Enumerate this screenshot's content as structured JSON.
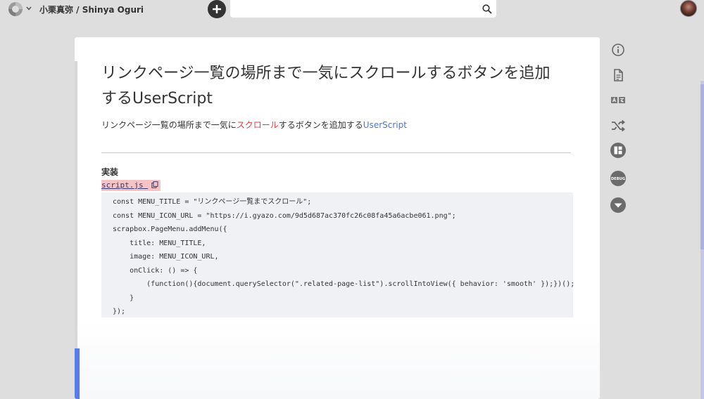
{
  "header": {
    "project_name": "小栗真弥 / Shinya Oguri",
    "search": {
      "value": "",
      "placeholder": ""
    }
  },
  "page": {
    "title": "リンクページ一覧の場所まで一気にスクロールするボタンを追加するUserScript",
    "summary": {
      "before": "リンクページ一覧の場所まで一気に",
      "link_red": "スクロール",
      "middle": "するボタンを追加する",
      "link_blue": "UserScript"
    },
    "section_heading": "実装",
    "code_filename": "script.js",
    "code_lines": [
      "const MENU_TITLE = \"リンクページ一覧までスクロール\";",
      "const MENU_ICON_URL = \"https://i.gyazo.com/9d5d687ac370fc26c08fa45a6acbe061.png\";",
      "scrapbox.PageMenu.addMenu({",
      "    title: MENU_TITLE,",
      "    image: MENU_ICON_URL,",
      "    onClick: () => {",
      "        (function(){document.querySelector(\".related-page-list\").scrollIntoView({ behavior: 'smooth' });})();",
      "    }",
      "});"
    ]
  },
  "sidebar": {
    "icons": [
      "info-icon",
      "document-icon",
      "translate-icon",
      "shuffle-icon",
      "layout-icon",
      "debug-icon",
      "chevron-down-circle-icon"
    ],
    "debug_label": "DEBUG"
  },
  "colors": {
    "background": "#dedede",
    "accent_blue": "#5b7bea",
    "link_red": "#e4393c",
    "link_blue": "#4a74d9",
    "code_bg": "#eff1f4",
    "filename_bg": "#f4c4c6"
  }
}
